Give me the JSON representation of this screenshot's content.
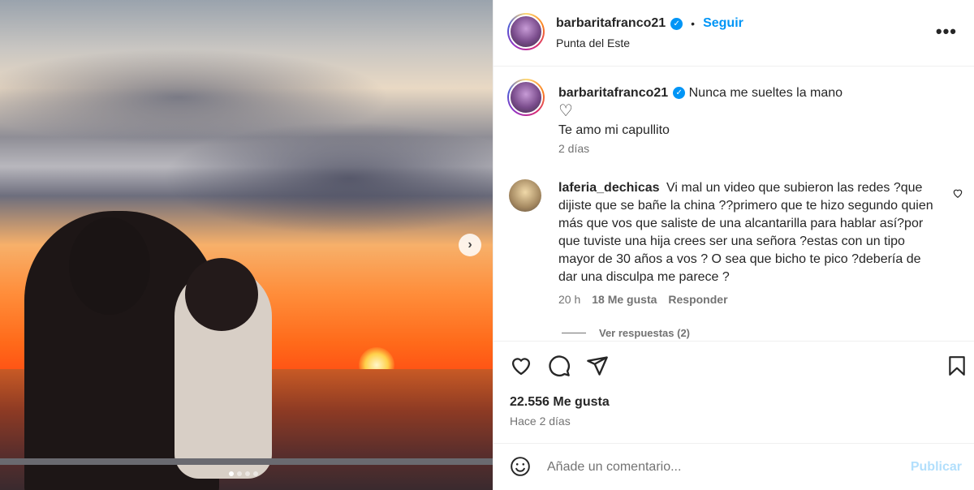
{
  "post": {
    "username": "barbaritafranco21",
    "verified": true,
    "follow_label": "Seguir",
    "bullet": "•",
    "location": "Punta del Este",
    "more_label": "•••",
    "carousel": {
      "slides": 4,
      "active_index": 0,
      "next_label": "›"
    }
  },
  "caption": {
    "username": "barbaritafranco21",
    "text_line1": "Nunca me sueltes la mano",
    "heart": "♡",
    "text_line2": "Te amo mi capullito",
    "time": "2 días"
  },
  "comment": {
    "username": "laferia_dechicas",
    "text": "Vi mal un video que subieron las redes ?que dijiste que se bañe la china ??primero que te hizo segundo quien más que vos que saliste de una alcantarilla para hablar así?por que tuviste una hija crees ser una señora ?estas con un tipo mayor de 30 años a vos ? O sea que bicho te pico ?debería de dar una disculpa me parece ?",
    "time": "20 h",
    "likes": "18 Me gusta",
    "reply_label": "Responder",
    "view_replies": "Ver respuestas (2)"
  },
  "actions": {
    "icons": [
      "heart-icon",
      "comment-icon",
      "share-icon",
      "bookmark-icon"
    ]
  },
  "likes_count": "22.556 Me gusta",
  "posted": "Hace 2 días",
  "add_comment": {
    "placeholder": "Añade un comentario...",
    "post_label": "Publicar"
  },
  "colors": {
    "accent": "#0095f6",
    "post_disabled": "#b2dffc",
    "secondary_text": "#737373"
  }
}
